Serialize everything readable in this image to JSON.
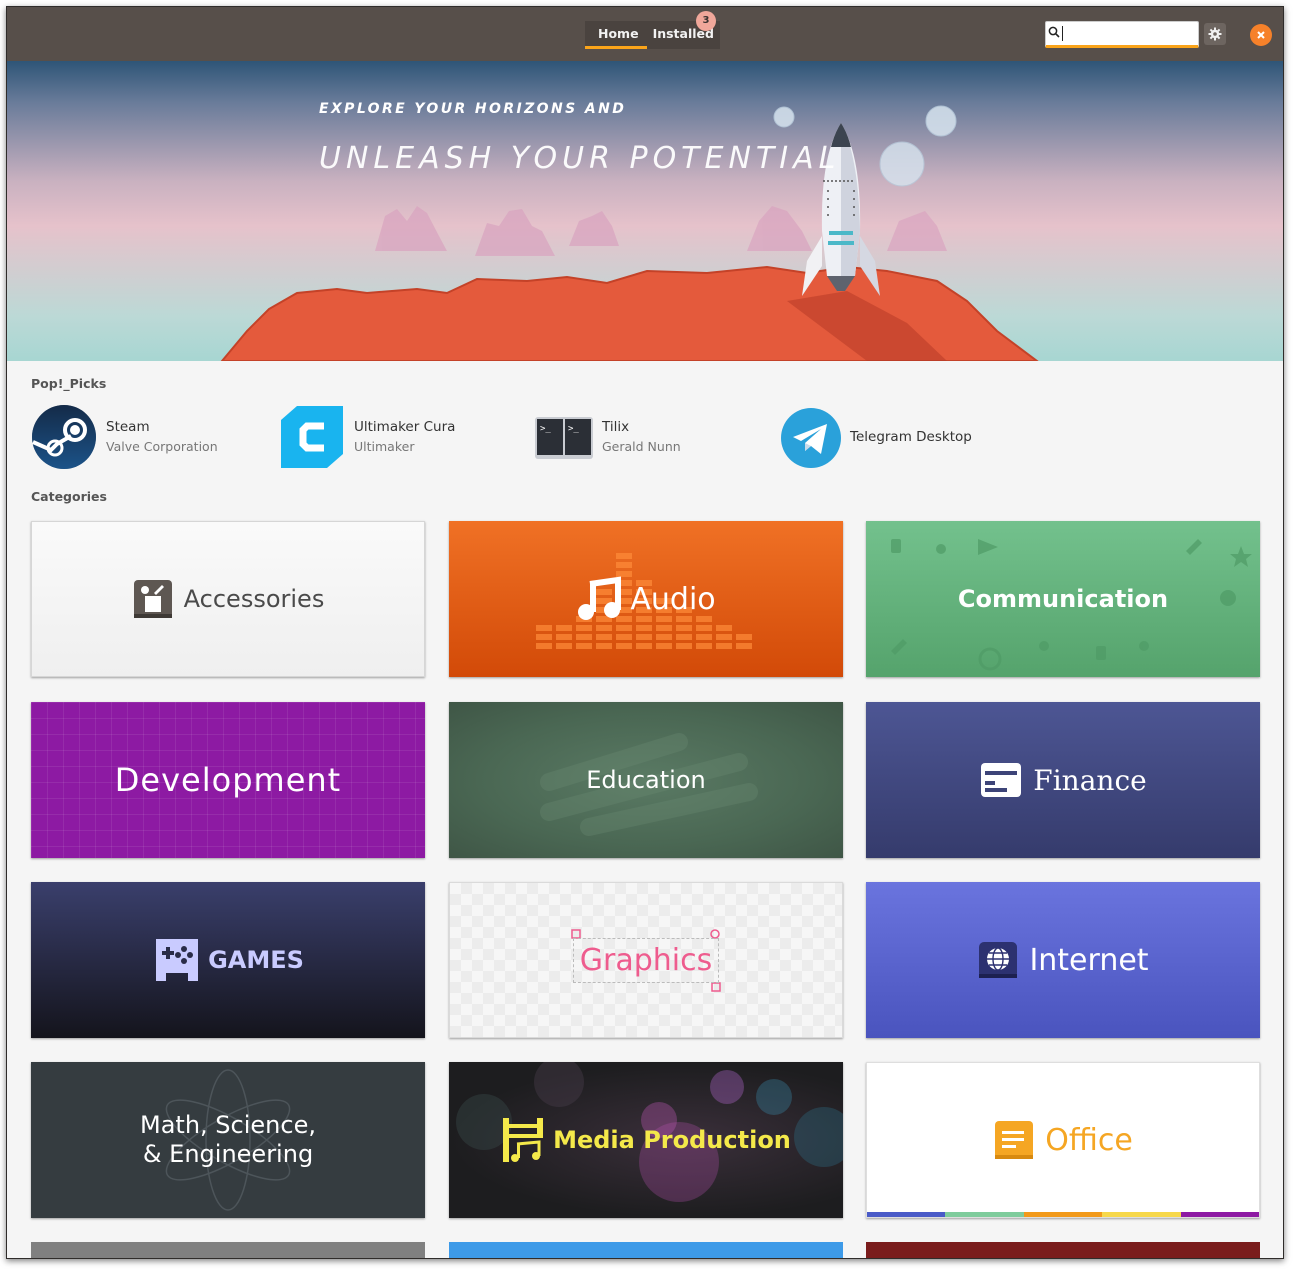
{
  "header": {
    "tabs": [
      {
        "label": "Home",
        "active": true
      },
      {
        "label": "Installed",
        "badge": "3"
      }
    ],
    "search": {
      "placeholder": "",
      "value": ""
    },
    "accent_color": "#faa41a"
  },
  "banner": {
    "line1": "EXPLORE YOUR HORIZONS AND",
    "line2": "UNLEASH YOUR POTENTIAL"
  },
  "picks": {
    "title": "Pop!_Picks",
    "items": [
      {
        "name": "Steam",
        "publisher": "Valve Corporation",
        "icon": "steam-icon"
      },
      {
        "name": "Ultimaker Cura",
        "publisher": "Ultimaker",
        "icon": "cura-icon"
      },
      {
        "name": "Tilix",
        "publisher": "Gerald Nunn",
        "icon": "tilix-icon"
      },
      {
        "name": "Telegram Desktop",
        "publisher": "",
        "icon": "telegram-icon"
      }
    ]
  },
  "categories": {
    "title": "Categories",
    "items": [
      {
        "label": "Accessories",
        "icon": "accessories-icon",
        "color": "#f3f3f3"
      },
      {
        "label": "Audio",
        "icon": "music-note-icon",
        "color": "#e95f15"
      },
      {
        "label": "Communication",
        "icon": "",
        "color": "#66b57f"
      },
      {
        "label": "Development",
        "icon": "",
        "color": "#8d1aa3"
      },
      {
        "label": "Education",
        "icon": "",
        "color": "#4e6b57"
      },
      {
        "label": "Finance",
        "icon": "credit-card-icon",
        "color": "#424a82"
      },
      {
        "label": "GAMES",
        "icon": "gamepad-icon",
        "color": "#2b2d4a"
      },
      {
        "label": "Graphics",
        "icon": "",
        "color": "#ee5c8e"
      },
      {
        "label": "Internet",
        "icon": "globe-icon",
        "color": "#5c66d0"
      },
      {
        "label": "Math, Science,",
        "label2": "& Engineering",
        "icon": "atom-icon",
        "color": "#353c40"
      },
      {
        "label": "Media Production",
        "icon": "film-music-icon",
        "color": "#1f1f22"
      },
      {
        "label": "Office",
        "icon": "document-icon",
        "color": "#f5a623"
      }
    ],
    "partial_colors": [
      "#808080",
      "#3d9ae8",
      "#7a1c1c"
    ]
  }
}
